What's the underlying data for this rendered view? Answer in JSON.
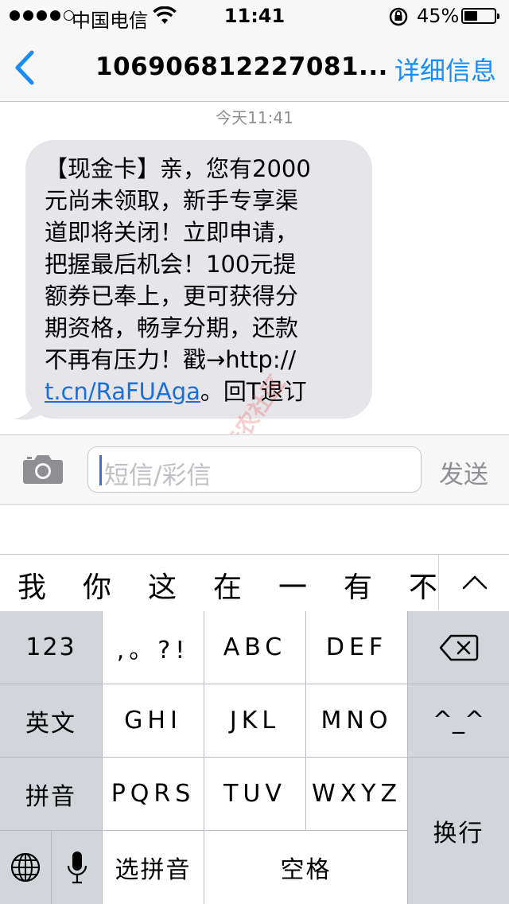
{
  "status": {
    "carrier": "中国电信",
    "time": "11:41",
    "battery_pct": "45%",
    "battery_level": 0.45
  },
  "nav": {
    "title": "106906812227081...",
    "details": "详细信息"
  },
  "conversation": {
    "timestamp": "今天11:41",
    "message_lines": [
      "【现金卡】亲，您有2000",
      "元尚未领取，新手专享渠",
      "道即将关闭！立即申请，",
      "把握最后机会！100元提",
      "额券已奉上，更可获得分",
      "期资格，畅享分期，还款",
      "不再有压力！戳→http://"
    ],
    "link_text": "t.cn/RaFUAga",
    "link_suffix": "。回T退订"
  },
  "watermark": "卡农社区",
  "composer": {
    "placeholder": "短信/彩信",
    "send": "发送"
  },
  "candidates": [
    "我",
    "你",
    "这",
    "在",
    "一",
    "有",
    "不"
  ],
  "keyboard": {
    "k123": "123",
    "punct": ",。?!",
    "abc": "ABC",
    "def": "DEF",
    "english": "英文",
    "ghi": "GHI",
    "jkl": "JKL",
    "mno": "MNO",
    "face": "^_^",
    "pinyin": "拼音",
    "pqrs": "PQRS",
    "tuv": "TUV",
    "wxyz": "WXYZ",
    "newline": "换行",
    "select_pinyin": "选拼音",
    "space": "空格"
  },
  "icons": {
    "back": "chevron-left-icon",
    "camera": "camera-icon",
    "backspace": "backspace-icon",
    "globe": "globe-icon",
    "mic": "microphone-icon",
    "collapse": "chevron-up-icon"
  },
  "colors": {
    "accent": "#1a8cf5",
    "bubble": "#e5e5ea",
    "keyboard_bg": "#b7bcc3"
  }
}
